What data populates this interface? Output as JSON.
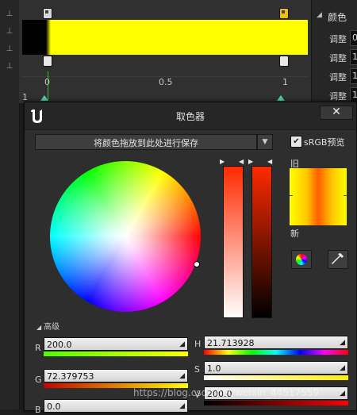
{
  "details": {
    "header": "颜色",
    "rows": [
      {
        "label": "调整",
        "value": "0"
      },
      {
        "label": "调整",
        "value": "1"
      },
      {
        "label": "调整",
        "value": "1"
      },
      {
        "label": "调整",
        "value": "1"
      }
    ]
  },
  "gradient": {
    "ticks": [
      "0",
      "0.5",
      "1"
    ],
    "left_marker": "1"
  },
  "picker": {
    "title": "取色器",
    "close_label": "✕",
    "save_drop_text": "将颜色拖放到此处进行保存",
    "srgb_label": "sRGB预览",
    "srgb_checked": true,
    "old_label": "旧",
    "new_label": "新",
    "advanced_label": "高级",
    "fields": {
      "R": {
        "label": "R",
        "value": "200.0"
      },
      "G": {
        "label": "G",
        "value": "72.379753"
      },
      "B": {
        "label": "B",
        "value": "0.0"
      },
      "H": {
        "label": "H",
        "value": "21.713928"
      },
      "S": {
        "label": "S",
        "value": "1.0"
      },
      "V": {
        "label": "V",
        "value": "200.0"
      }
    }
  },
  "colors": {
    "gradient_start": "#000000",
    "gradient_end": "#ffff00",
    "selected": "#ff2a00"
  },
  "watermark": "https://blog.csdn.net/weixin_44517559"
}
